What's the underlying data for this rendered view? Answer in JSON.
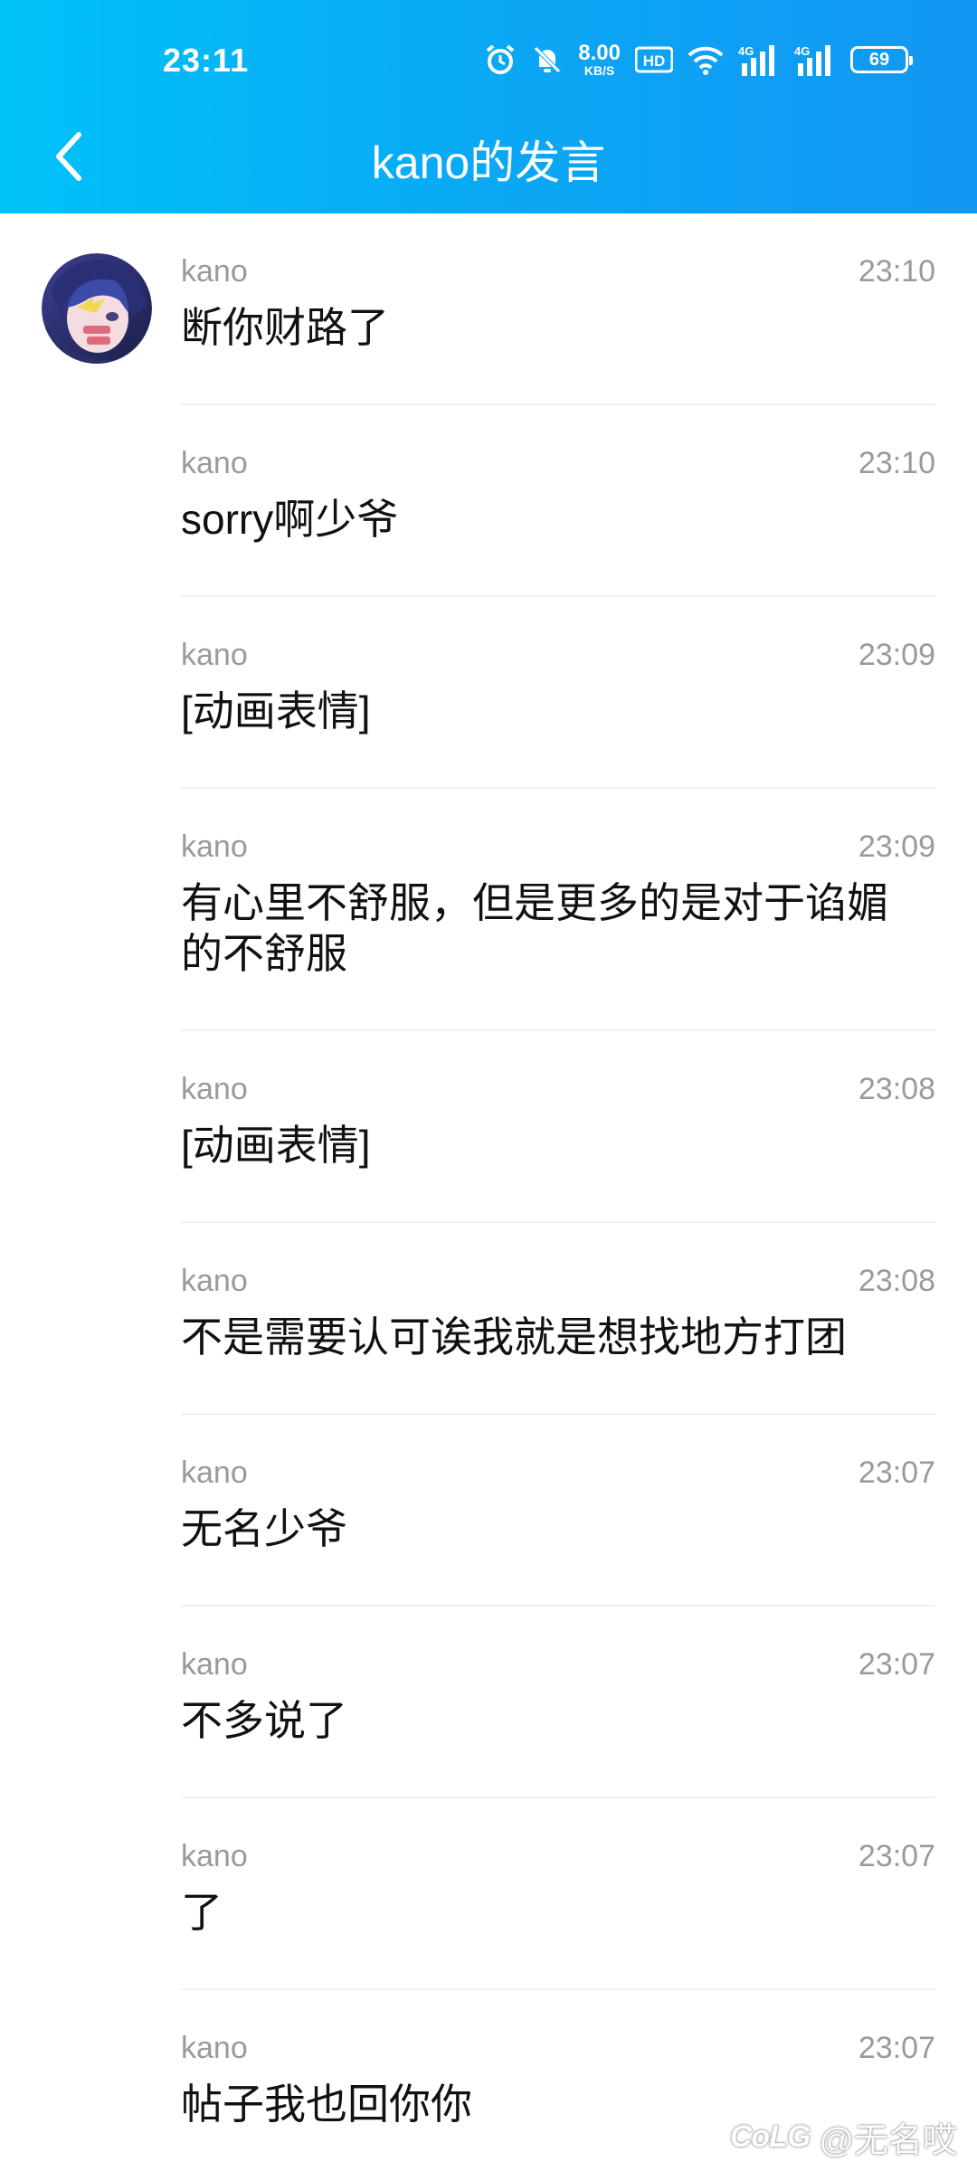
{
  "status_bar": {
    "time": "23:11",
    "net_speed_value": "8.00",
    "net_speed_unit": "KB/S",
    "hd_label": "HD",
    "signal1_label": "4G",
    "signal2_label": "4G",
    "battery": "69",
    "icons": [
      "alarm-icon",
      "mute-icon",
      "hd-icon",
      "wifi-icon",
      "signal-icon",
      "signal-icon",
      "battery-icon"
    ]
  },
  "header": {
    "title": "kano的发言",
    "bg_start": "#00c2f8",
    "bg_end": "#1297f2"
  },
  "messages": [
    {
      "name": "kano",
      "time": "23:10",
      "content": "断你财路了"
    },
    {
      "name": "kano",
      "time": "23:10",
      "content": "sorry啊少爷"
    },
    {
      "name": "kano",
      "time": "23:09",
      "content": "[动画表情]"
    },
    {
      "name": "kano",
      "time": "23:09",
      "content": "有心里不舒服，但是更多的是对于谄媚的不舒服"
    },
    {
      "name": "kano",
      "time": "23:08",
      "content": "[动画表情]"
    },
    {
      "name": "kano",
      "time": "23:08",
      "content": "不是需要认可诶我就是想找地方打团"
    },
    {
      "name": "kano",
      "time": "23:07",
      "content": "无名少爷"
    },
    {
      "name": "kano",
      "time": "23:07",
      "content": "不多说了"
    },
    {
      "name": "kano",
      "time": "23:07",
      "content": "了"
    },
    {
      "name": "kano",
      "time": "23:07",
      "content": "帖子我也回你你"
    }
  ],
  "watermark": {
    "logo": "CoLG",
    "handle": "@无名哎"
  }
}
